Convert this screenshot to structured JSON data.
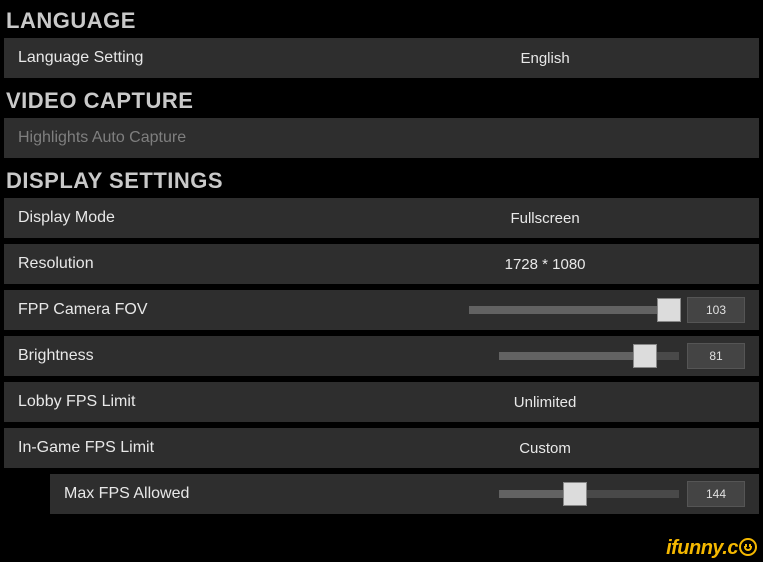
{
  "sections": {
    "language": {
      "header": "LANGUAGE",
      "setting_label": "Language Setting",
      "setting_value": "English"
    },
    "video_capture": {
      "header": "VIDEO CAPTURE",
      "highlights_label": "Highlights Auto Capture"
    },
    "display": {
      "header": "DISPLAY SETTINGS",
      "display_mode_label": "Display Mode",
      "display_mode_value": "Fullscreen",
      "resolution_label": "Resolution",
      "resolution_value": "1728 * 1080",
      "fov_label": "FPP Camera FOV",
      "fov_value": "103",
      "brightness_label": "Brightness",
      "brightness_value": "81",
      "lobby_fps_label": "Lobby FPS Limit",
      "lobby_fps_value": "Unlimited",
      "ingame_fps_label": "In-Game FPS Limit",
      "ingame_fps_value": "Custom",
      "max_fps_label": "Max FPS Allowed",
      "max_fps_value": "144"
    }
  },
  "sliders": {
    "fov": {
      "min": 80,
      "max": 103,
      "value": 103
    },
    "brightness": {
      "min": 0,
      "max": 100,
      "value": 81
    },
    "max_fps": {
      "min": 30,
      "max": 300,
      "value": 144
    }
  },
  "watermark": "ifunny.c"
}
